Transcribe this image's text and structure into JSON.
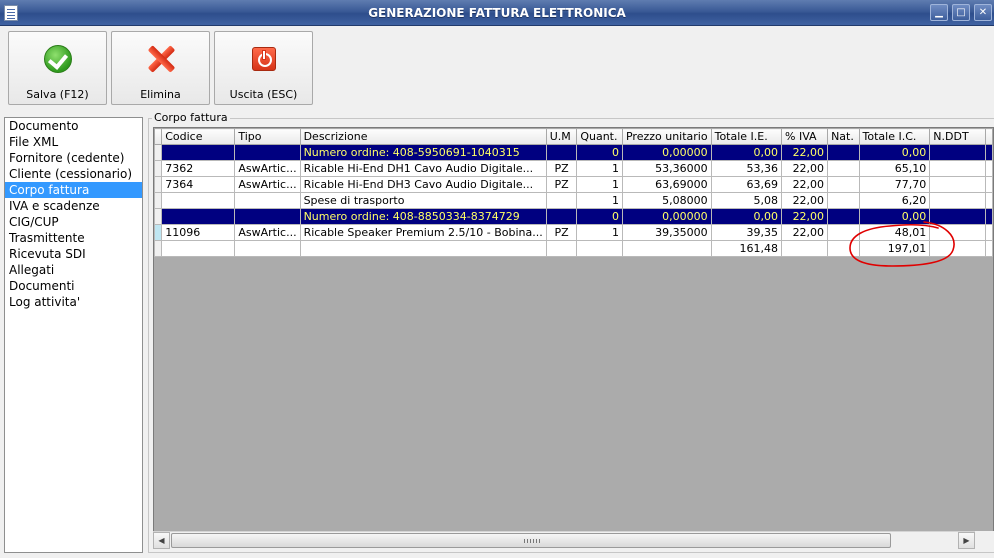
{
  "window": {
    "title": "GENERAZIONE FATTURA ELETTRONICA",
    "min_glyph": "▁",
    "max_glyph": "□",
    "close_glyph": "✕"
  },
  "toolbar": {
    "save_label": "Salva (F12)",
    "delete_label": "Elimina",
    "exit_label": "Uscita (ESC)"
  },
  "nav": {
    "items": [
      {
        "label": "Documento"
      },
      {
        "label": "File XML"
      },
      {
        "label": "Fornitore (cedente)"
      },
      {
        "label": "Cliente (cessionario)"
      },
      {
        "label": "Corpo fattura",
        "selected": true
      },
      {
        "label": "IVA e scadenze"
      },
      {
        "label": "CIG/CUP"
      },
      {
        "label": "Trasmittente"
      },
      {
        "label": "Ricevuta SDI"
      },
      {
        "label": "Allegati"
      },
      {
        "label": "Documenti"
      },
      {
        "label": "Log attivita'"
      }
    ]
  },
  "group_title": "Corpo fattura",
  "grid": {
    "columns": [
      "Codice",
      "Tipo",
      "Descrizione",
      "U.M",
      "Quant.",
      "Prezzo unitario",
      "Totale I.E.",
      "% IVA",
      "Nat.",
      "Totale I.C.",
      "N.DDT"
    ],
    "rows": [
      {
        "order": true,
        "cells": [
          "",
          "",
          "Numero ordine: 408-5950691-1040315",
          "",
          "0",
          "0,00000",
          "0,00",
          "22,00",
          "",
          "0,00",
          ""
        ]
      },
      {
        "cells": [
          "7362",
          "AswArtic...",
          "Ricable Hi-End DH1 Cavo Audio Digitale...",
          "PZ",
          "1",
          "53,36000",
          "53,36",
          "22,00",
          "",
          "65,10",
          ""
        ]
      },
      {
        "cells": [
          "7364",
          "AswArtic...",
          "Ricable Hi-End DH3 Cavo Audio Digitale...",
          "PZ",
          "1",
          "63,69000",
          "63,69",
          "22,00",
          "",
          "77,70",
          ""
        ]
      },
      {
        "cells": [
          "",
          "",
          "Spese di trasporto",
          "",
          "1",
          "5,08000",
          "5,08",
          "22,00",
          "",
          "6,20",
          ""
        ]
      },
      {
        "order": true,
        "cells": [
          "",
          "",
          "Numero ordine: 408-8850334-8374729",
          "",
          "0",
          "0,00000",
          "0,00",
          "22,00",
          "",
          "0,00",
          ""
        ]
      },
      {
        "active": true,
        "cells": [
          "11096",
          "AswArtic...",
          "Ricable Speaker Premium 2.5/10 - Bobina...",
          "PZ",
          "1",
          "39,35000",
          "39,35",
          "22,00",
          "",
          "48,01",
          ""
        ]
      },
      {
        "total": true,
        "cells": [
          "",
          "",
          "",
          "",
          "",
          "",
          "161,48",
          "",
          "",
          "197,01",
          ""
        ]
      }
    ]
  },
  "scrollbar": {
    "left_glyph": "◀",
    "right_glyph": "▶"
  },
  "colors": {
    "order_row_bg": "#000080",
    "order_row_text": "#ffff66",
    "selection": "#3399ff",
    "annotation": "#e00000"
  }
}
